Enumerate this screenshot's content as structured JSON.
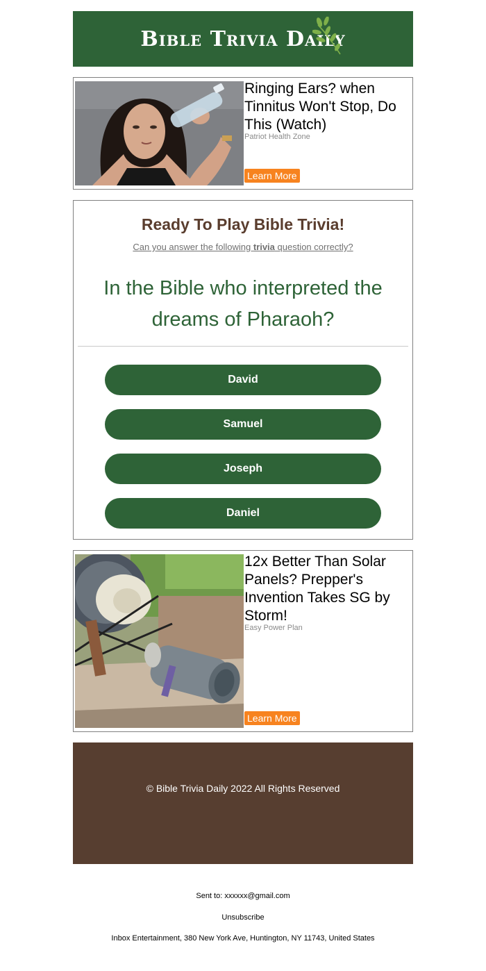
{
  "header": {
    "title": "Bible Trivia Daily"
  },
  "ads": [
    {
      "headline": "Ringing Ears? when Tinnitus Won't Stop, Do This (Watch)",
      "sponsor": "Patriot Health Zone",
      "button_label": "Learn More",
      "image_icon": "woman-with-water-bottle-photo"
    },
    {
      "headline": "12x Better Than Solar Panels? Prepper's Invention Takes SG by Storm!",
      "sponsor": "Easy Power Plan",
      "button_label": "Learn More",
      "image_icon": "motor-pulley-device-photo"
    }
  ],
  "quiz": {
    "heading": "Ready To Play Bible Trivia!",
    "sub_prefix": "Can you answer the following ",
    "sub_bold": "trivia",
    "sub_suffix": " question correctly?",
    "question": "In the Bible who interpreted the dreams of Pharaoh?",
    "answers": [
      "David",
      "Samuel",
      "Joseph",
      "Daniel"
    ]
  },
  "footer": {
    "copyright": "© Bible Trivia Daily 2022 All Rights Reserved",
    "sent_to": "Sent to: xxxxxx@gmail.com",
    "unsubscribe": "Unsubscribe",
    "address": "Inbox Entertainment, 380 New York Ave, Huntington, NY 11743, United States"
  },
  "colors": {
    "brand_green": "#2e6337",
    "brand_brown": "#573e30",
    "heading_brown": "#5a3d2e",
    "cta_orange": "#f7831f"
  }
}
